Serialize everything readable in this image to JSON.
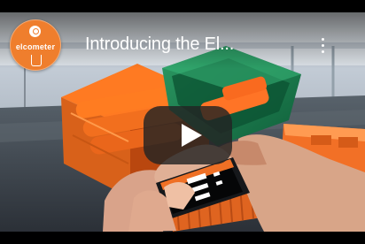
{
  "video": {
    "title": "Introducing the El...",
    "channel_name": "elcometer",
    "play_label": "Play"
  },
  "icons": {
    "more": "more-vertical-icon",
    "play": "play-icon"
  },
  "colors": {
    "brand_orange": "#ef7e2d",
    "player_overlay": "#232323",
    "title_text": "#ffffff"
  }
}
